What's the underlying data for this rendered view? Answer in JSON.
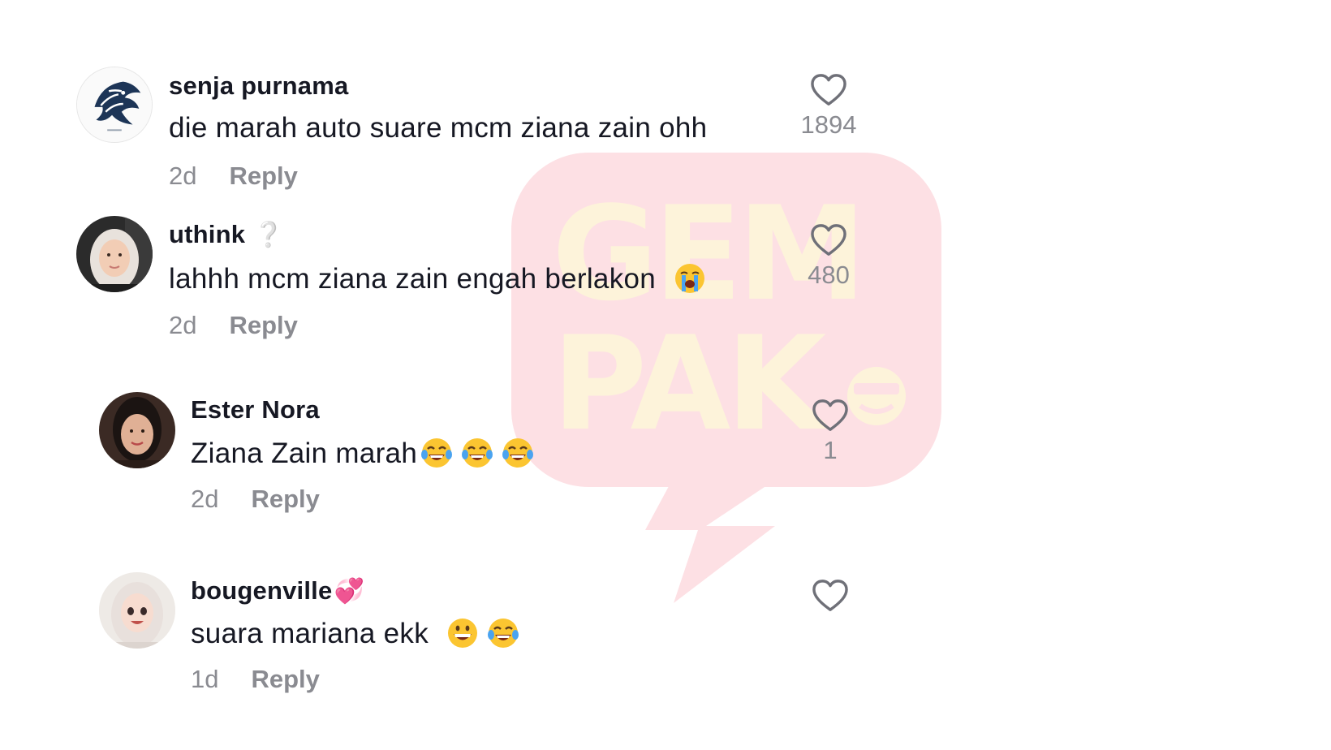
{
  "watermark": {
    "text": "GEMPAK"
  },
  "comments": [
    {
      "username": "senja purnama",
      "badge": "",
      "text": "die marah auto suare mcm ziana zain ohh",
      "emojis": [],
      "time": "2d",
      "reply_label": "Reply",
      "likes": "1894",
      "avatar": "tiger-logo"
    },
    {
      "username": "uthink",
      "badge": "❔",
      "text": "lahhh mcm ziana zain engah berlakon",
      "emojis": [
        "loudly-crying-face"
      ],
      "time": "2d",
      "reply_label": "Reply",
      "likes": "480",
      "avatar": "woman-hijab-photo"
    },
    {
      "username": "Ester Nora",
      "badge": "",
      "text": "Ziana Zain marah",
      "emojis": [
        "tears-of-joy",
        "tears-of-joy",
        "tears-of-joy"
      ],
      "time": "2d",
      "reply_label": "Reply",
      "likes": "1",
      "avatar": "woman-photo"
    },
    {
      "username": "bougenville",
      "badge": "💞",
      "text": "suara mariana ekk",
      "emojis": [
        "grinning-face",
        "tears-of-joy"
      ],
      "time": "1d",
      "reply_label": "Reply",
      "likes": "",
      "avatar": "cartoon-hijab-avatar"
    }
  ],
  "colors": {
    "text": "#161823",
    "muted": "#8a8b91",
    "watermark_pink": "#fde0e4",
    "watermark_yellow": "#fdf3da"
  }
}
